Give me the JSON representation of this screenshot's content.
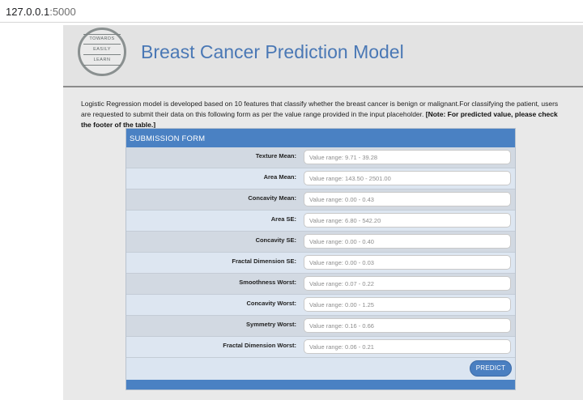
{
  "browser": {
    "url_host": "127.0.0.1",
    "url_port": ":5000"
  },
  "header": {
    "logo_words": [
      "TOWARDS",
      "EASILY",
      "LEARN"
    ],
    "title": "Breast Cancer Prediction Model"
  },
  "description": {
    "text": "Logistic Regression model is developed based on 10 features that classify whether the breast cancer is benign or malignant.For classifying the patient, users are requested to submit their data on this following form as per the value range provided in the input placeholder. ",
    "note": "[Note: For predicted value, please check the footer of the table.]"
  },
  "form": {
    "heading": "SUBMISSION FORM",
    "fields": [
      {
        "label": "Texture Mean:",
        "placeholder": "Value range: 9.71 - 39.28"
      },
      {
        "label": "Area Mean:",
        "placeholder": "Value range: 143.50 - 2501.00"
      },
      {
        "label": "Concavity Mean:",
        "placeholder": "Value range: 0.00 - 0.43"
      },
      {
        "label": "Area SE:",
        "placeholder": "Value range: 6.80 - 542.20"
      },
      {
        "label": "Concavity SE:",
        "placeholder": "Value range: 0.00 - 0.40"
      },
      {
        "label": "Fractal Dimension SE:",
        "placeholder": "Value range: 0.00 - 0.03"
      },
      {
        "label": "Smoothness Worst:",
        "placeholder": "Value range: 0.07 - 0.22"
      },
      {
        "label": "Concavity Worst:",
        "placeholder": "Value range: 0.00 - 1.25"
      },
      {
        "label": "Symmetry Worst:",
        "placeholder": "Value range: 0.16 - 0.66"
      },
      {
        "label": "Fractal Dimension Worst:",
        "placeholder": "Value range: 0.06 - 0.21"
      }
    ],
    "submit_label": "PREDICT"
  }
}
